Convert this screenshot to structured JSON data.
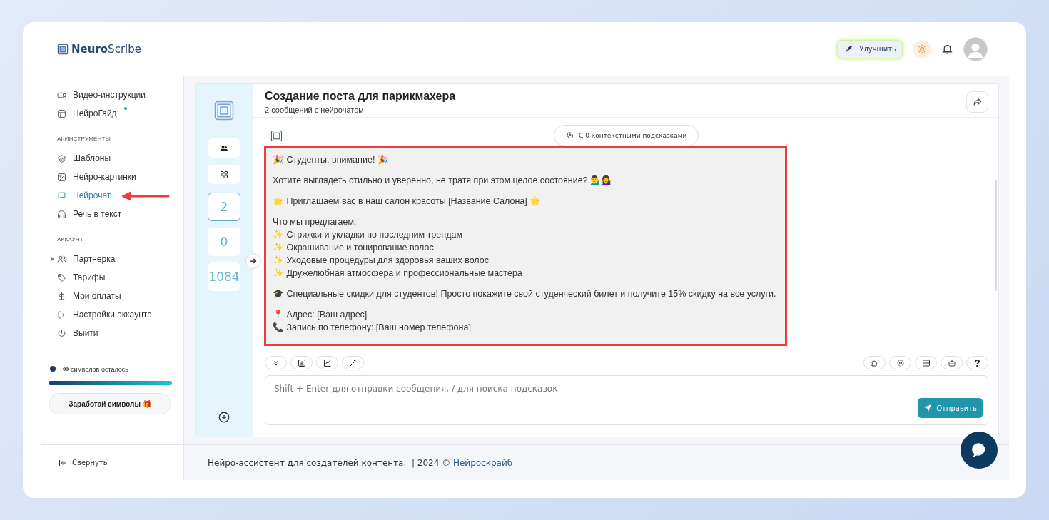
{
  "brand": {
    "bold": "Neuro",
    "rest": "Scribe"
  },
  "topbar": {
    "upgrade_button": "Улучшить"
  },
  "sidebar": {
    "sections": [
      {
        "items": [
          {
            "label": "Видео-инструкции",
            "selected": false
          },
          {
            "label": "НейроГайд",
            "selected": false,
            "badge": true
          }
        ]
      },
      {
        "heading": "AI-ИНСТРУМЕНТЫ",
        "items": [
          {
            "label": "Шаблоны",
            "selected": false
          },
          {
            "label": "Нейро-картинки",
            "selected": false
          },
          {
            "label": "Нейрочат",
            "selected": true
          },
          {
            "label": "Речь в текст",
            "selected": false
          }
        ]
      },
      {
        "heading": "АККАУНТ",
        "items": [
          {
            "label": "Партнерка",
            "selected": false,
            "expanded": false
          },
          {
            "label": "Тарифы",
            "selected": false
          },
          {
            "label": "Мои оплаты",
            "selected": false
          },
          {
            "label": "Настройки аккаунта",
            "selected": false
          },
          {
            "label": "Выйти",
            "selected": false
          }
        ]
      }
    ],
    "credits": {
      "count": "∞",
      "label": "символов осталось",
      "level": 1
    },
    "earn_button": "Заработай символы 🎁",
    "collapse": "Свернуть"
  },
  "chat": {
    "title": "Создание поста для парикмахера",
    "subtitle": "2 сообщений с нейрочатом",
    "context_chip": "С 0 контекстными подсказками",
    "counters": [
      {
        "value": "2",
        "selected": true
      },
      {
        "value": "0",
        "selected": false
      },
      {
        "value": "1084",
        "selected": false
      }
    ],
    "message": [
      [
        "🎉 Студенты, внимание! 🎉"
      ],
      [
        "Хотите выглядеть стильно и уверенно, не тратя при этом целое состояние? 💁‍♂️💁‍♀️"
      ],
      [
        "🌟 Приглашаем вас в наш салон красоты [Название Салона] 🌟"
      ],
      [
        "Что мы предлагаем:",
        "✨ Стрижки и укладки по последним трендам",
        "✨ Окрашивание и тонирование волос",
        "✨ Уходовые процедуры для здоровья ваших волос",
        "✨ Дружелюбная атмосфера и профессиональные мастера"
      ],
      [
        "🎓 Специальные скидки для студентов! Просто покажите свой студенческий билет и получите 15% скидку на все услуги."
      ],
      [
        "📍 Адрес: [Ваш адрес]",
        "📞 Запись по телефону: [Ваш номер телефона]"
      ]
    ],
    "help_button": "?",
    "input": {
      "placeholder": "Shift + Enter для отправки сообщения, / для поиска подсказок"
    },
    "send_button": "Отправить"
  },
  "footer": {
    "text": "Нейро-ассистент для создателей контента.  | 2024 © ",
    "link": "Нейроскрайб"
  }
}
